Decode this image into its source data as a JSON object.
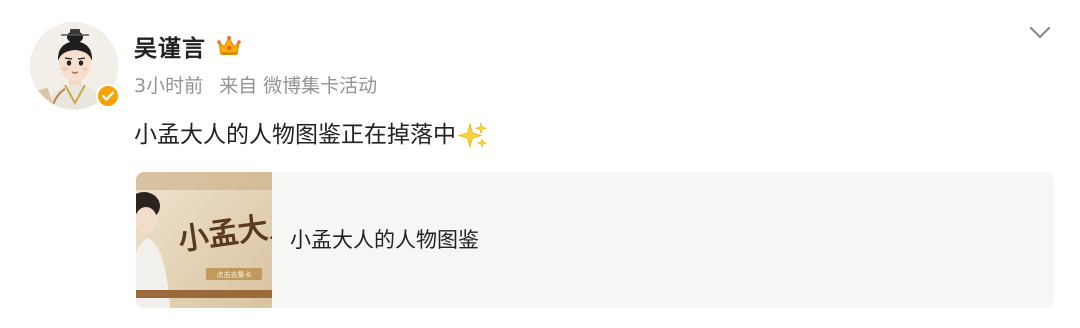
{
  "post": {
    "author": {
      "name": "吴谨言",
      "crown_icon": "crown-icon",
      "verified_icon": "verified-check-icon",
      "verified_color": "#f7a200"
    },
    "meta": {
      "time": "3小时前",
      "source_prefix": "来自",
      "source": "微博集卡活动"
    },
    "text": "小孟大人的人物图鉴正在掉落中",
    "text_emoji": "sparkles-icon",
    "card": {
      "title": "小孟大人的人物图鉴",
      "thumb_text": "小孟大人图",
      "thumb_subtext": "点击去集卡"
    },
    "menu_icon": "chevron-down-icon"
  }
}
